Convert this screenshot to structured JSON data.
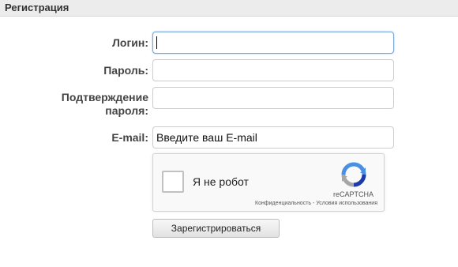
{
  "header": {
    "title": "Регистрация"
  },
  "form": {
    "login_label": "Логин:",
    "password_label": "Пароль:",
    "confirm_label_line1": "Подтверждение",
    "confirm_label_line2": "пароля:",
    "email_label": "E-mail:",
    "login_value": "",
    "password_value": "",
    "confirm_value": "",
    "email_placeholder": "Введите ваш E-mail"
  },
  "recaptcha": {
    "label": "Я не робот",
    "brand": "reCAPTCHA",
    "privacy": "Конфиденциальность",
    "separator": " - ",
    "terms": "Условия использования",
    "checked": false
  },
  "submit_label": "Зарегистрироваться",
  "colors": {
    "header_bg": "#ececec",
    "focus_border": "#7aa6d8",
    "recaptcha_blue": "#4a90e2",
    "recaptcha_gray": "#a6a6a6"
  }
}
